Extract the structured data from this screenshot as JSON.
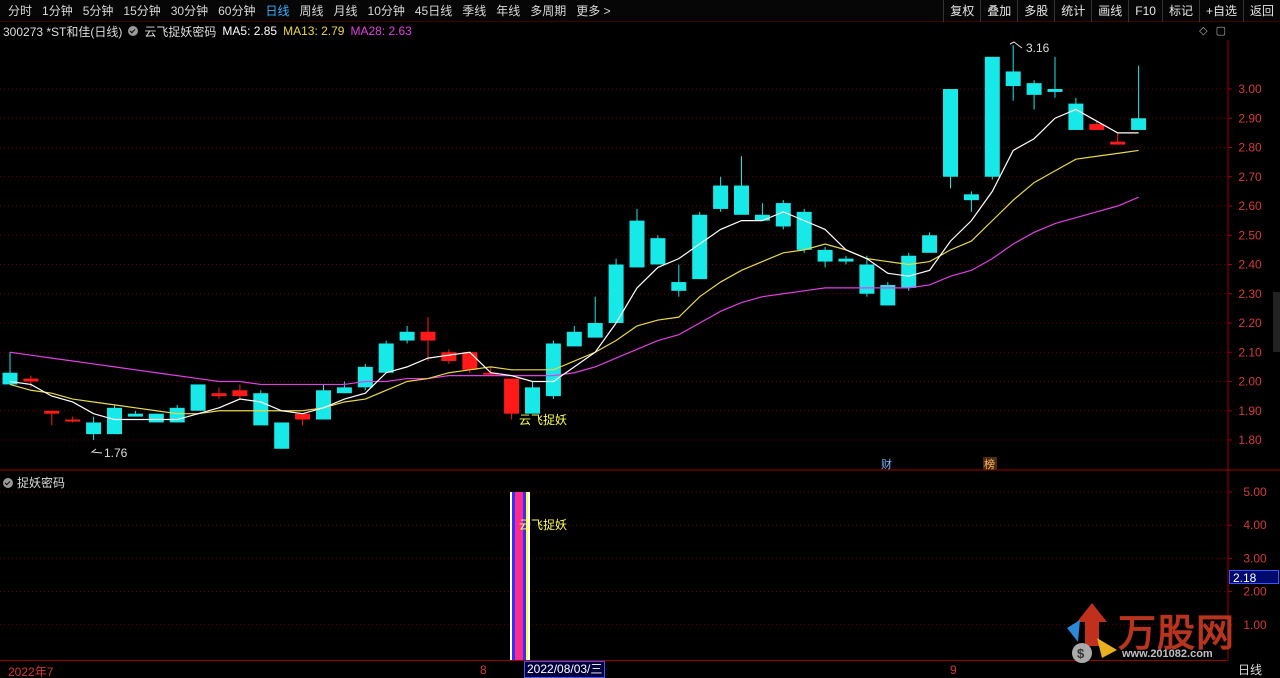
{
  "toolbar": {
    "periods": [
      "分时",
      "1分钟",
      "5分钟",
      "15分钟",
      "30分钟",
      "60分钟",
      "日线",
      "周线",
      "月线",
      "10分钟",
      "45日线",
      "季线",
      "年线",
      "多周期",
      "更多 >"
    ],
    "active": "日线",
    "buttons": [
      "复权",
      "叠加",
      "多股",
      "统计",
      "画线",
      "F10",
      "标记",
      "+自选",
      "返回"
    ]
  },
  "info": {
    "stock": "300273 *ST和佳(日线)",
    "indicator_name": "云飞捉妖密码",
    "ma5": "MA5: 2.85",
    "ma13": "MA13: 2.79",
    "ma28": "MA28: 2.63",
    "colors": {
      "ma5": "#ffffff",
      "ma13": "#e8d84a",
      "ma28": "#e040e0",
      "up": "#ff1a1a",
      "down": "#17e8e8"
    }
  },
  "lower_panel": {
    "title": "捉妖密码",
    "signal_label": "云飞捉妖",
    "current_value": "2.18",
    "y_ticks": [
      "5.00",
      "4.00",
      "3.00",
      "2.00",
      "1.00"
    ]
  },
  "chart_data": {
    "type": "candlestick",
    "y_ticks": [
      "3.00",
      "2.90",
      "2.80",
      "2.70",
      "2.60",
      "2.50",
      "2.40",
      "2.30",
      "2.20",
      "2.10",
      "2.00",
      "1.90",
      "1.80"
    ],
    "ylim": [
      1.76,
      3.18
    ],
    "high_label": "3.16",
    "low_label": "1.76",
    "signal_label": "云飞捉妖",
    "badges": [
      "财",
      "榜"
    ],
    "ohlc": [
      [
        2.03,
        2.1,
        1.99,
        1.99
      ],
      [
        2.0,
        2.02,
        1.98,
        2.01
      ],
      [
        1.89,
        1.9,
        1.85,
        1.9
      ],
      [
        1.87,
        1.88,
        1.86,
        1.87
      ],
      [
        1.86,
        1.88,
        1.8,
        1.82
      ],
      [
        1.91,
        1.92,
        1.83,
        1.82
      ],
      [
        1.89,
        1.9,
        1.88,
        1.88
      ],
      [
        1.89,
        1.89,
        1.86,
        1.86
      ],
      [
        1.91,
        1.92,
        1.86,
        1.86
      ],
      [
        1.99,
        1.99,
        1.9,
        1.9
      ],
      [
        1.95,
        1.98,
        1.94,
        1.96
      ],
      [
        1.95,
        1.99,
        1.94,
        1.97
      ],
      [
        1.96,
        1.97,
        1.85,
        1.85
      ],
      [
        1.86,
        1.86,
        1.77,
        1.77
      ],
      [
        1.87,
        1.89,
        1.85,
        1.89
      ],
      [
        1.97,
        1.99,
        1.88,
        1.87
      ],
      [
        1.98,
        2.0,
        1.96,
        1.96
      ],
      [
        2.05,
        2.06,
        1.97,
        1.98
      ],
      [
        2.13,
        2.14,
        2.03,
        2.03
      ],
      [
        2.17,
        2.19,
        2.13,
        2.14
      ],
      [
        2.14,
        2.22,
        2.07,
        2.17
      ],
      [
        2.07,
        2.11,
        2.06,
        2.1
      ],
      [
        2.04,
        2.1,
        2.03,
        2.1
      ],
      [
        2.03,
        2.05,
        2.02,
        2.03
      ],
      [
        1.89,
        2.01,
        1.87,
        2.01
      ],
      [
        1.98,
        2.0,
        1.89,
        1.89
      ],
      [
        2.13,
        2.14,
        1.94,
        1.95
      ],
      [
        2.17,
        2.19,
        2.12,
        2.12
      ],
      [
        2.2,
        2.29,
        2.15,
        2.15
      ],
      [
        2.4,
        2.42,
        2.2,
        2.2
      ],
      [
        2.55,
        2.59,
        2.39,
        2.39
      ],
      [
        2.49,
        2.5,
        2.4,
        2.4
      ],
      [
        2.34,
        2.4,
        2.29,
        2.31
      ],
      [
        2.57,
        2.58,
        2.35,
        2.35
      ],
      [
        2.67,
        2.7,
        2.58,
        2.59
      ],
      [
        2.67,
        2.77,
        2.57,
        2.57
      ],
      [
        2.57,
        2.61,
        2.55,
        2.55
      ],
      [
        2.61,
        2.62,
        2.52,
        2.53
      ],
      [
        2.58,
        2.59,
        2.44,
        2.45
      ],
      [
        2.45,
        2.46,
        2.39,
        2.41
      ],
      [
        2.42,
        2.43,
        2.4,
        2.41
      ],
      [
        2.4,
        2.43,
        2.29,
        2.3
      ],
      [
        2.33,
        2.34,
        2.26,
        2.26
      ],
      [
        2.43,
        2.44,
        2.31,
        2.32
      ],
      [
        2.5,
        2.51,
        2.44,
        2.44
      ],
      [
        3.0,
        3.0,
        2.66,
        2.7
      ],
      [
        2.64,
        2.65,
        2.58,
        2.62
      ],
      [
        3.11,
        3.11,
        2.69,
        2.7
      ],
      [
        3.06,
        3.15,
        2.96,
        3.01
      ],
      [
        3.02,
        3.03,
        2.93,
        2.98
      ],
      [
        3.0,
        3.11,
        2.97,
        2.99
      ],
      [
        2.95,
        2.97,
        2.86,
        2.86
      ],
      [
        2.86,
        2.89,
        2.86,
        2.88
      ],
      [
        2.81,
        2.85,
        2.81,
        2.82
      ],
      [
        2.9,
        3.08,
        2.86,
        2.86
      ]
    ],
    "ma5": [
      2.0,
      1.99,
      1.95,
      1.93,
      1.89,
      1.87,
      1.87,
      1.87,
      1.87,
      1.89,
      1.91,
      1.94,
      1.93,
      1.9,
      1.89,
      1.91,
      1.94,
      1.96,
      2.03,
      2.05,
      2.08,
      2.09,
      2.1,
      2.03,
      2.02,
      2.0,
      2.0,
      2.05,
      2.1,
      2.2,
      2.32,
      2.39,
      2.42,
      2.47,
      2.52,
      2.55,
      2.55,
      2.58,
      2.55,
      2.52,
      2.45,
      2.42,
      2.37,
      2.36,
      2.38,
      2.48,
      2.55,
      2.65,
      2.79,
      2.83,
      2.9,
      2.93,
      2.89,
      2.85,
      2.85
    ],
    "ma13": [
      1.99,
      1.97,
      1.96,
      1.94,
      1.93,
      1.92,
      1.91,
      1.9,
      1.89,
      1.89,
      1.9,
      1.9,
      1.9,
      1.9,
      1.9,
      1.91,
      1.93,
      1.94,
      1.97,
      2.0,
      2.01,
      2.03,
      2.04,
      2.05,
      2.04,
      2.04,
      2.04,
      2.07,
      2.1,
      2.14,
      2.19,
      2.21,
      2.22,
      2.29,
      2.34,
      2.38,
      2.41,
      2.44,
      2.45,
      2.47,
      2.45,
      2.42,
      2.41,
      2.4,
      2.41,
      2.45,
      2.48,
      2.55,
      2.62,
      2.68,
      2.72,
      2.76,
      2.77,
      2.78,
      2.79
    ],
    "ma28": [
      2.1,
      2.09,
      2.08,
      2.07,
      2.06,
      2.05,
      2.04,
      2.03,
      2.02,
      2.01,
      2.0,
      2.0,
      1.99,
      1.99,
      1.99,
      1.99,
      1.99,
      2.0,
      2.0,
      2.01,
      2.01,
      2.02,
      2.02,
      2.02,
      2.02,
      2.02,
      2.02,
      2.03,
      2.05,
      2.08,
      2.11,
      2.14,
      2.16,
      2.2,
      2.24,
      2.27,
      2.29,
      2.3,
      2.31,
      2.32,
      2.32,
      2.32,
      2.32,
      2.32,
      2.33,
      2.36,
      2.38,
      2.42,
      2.47,
      2.51,
      2.54,
      2.56,
      2.58,
      2.6,
      2.63
    ]
  },
  "dates": {
    "jul": "2022年7",
    "aug": "8",
    "selected": "2022/08/03/三",
    "sep": "9"
  },
  "period_label": "日线",
  "watermark": {
    "text": "万股网",
    "url": "www.201082.com"
  }
}
